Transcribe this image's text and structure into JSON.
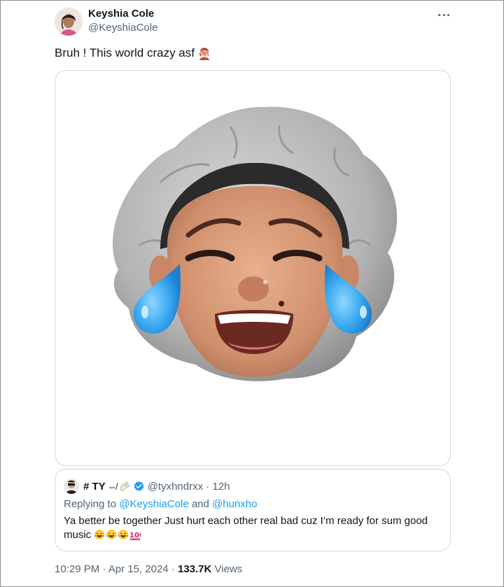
{
  "author": {
    "display_name": "Keyshia Cole",
    "handle": "@KeyshiaCole"
  },
  "tweet": {
    "text": "Bruh ! This world crazy asf",
    "emoji": "woman-facepalming"
  },
  "media": {
    "description_icon": "crying-laughing-memoji"
  },
  "quote": {
    "display_name": "# TY",
    "name_decoration": "⇎",
    "handle": "@tyxhndrxx",
    "time": "· 12h",
    "replying_prefix": "Replying to",
    "reply_mention_1": "@KeyshiaCole",
    "reply_and": "and",
    "reply_mention_2": "@hunxho",
    "body": "Ya better be together Just hurt each other real bad cuz I’m ready for sum good music",
    "body_emojis": [
      "face-with-tears-of-joy",
      "face-with-tears-of-joy",
      "face-with-tears-of-joy",
      "hundred-points"
    ]
  },
  "meta": {
    "time": "10:29 PM",
    "separator_1": "·",
    "date": "Apr 15, 2024",
    "separator_2": "·",
    "views_count": "133.7K",
    "views_label": "Views"
  },
  "colors": {
    "text": "#0f1419",
    "secondary": "#536471",
    "link": "#1d9bf0",
    "border": "#cfd9de"
  }
}
